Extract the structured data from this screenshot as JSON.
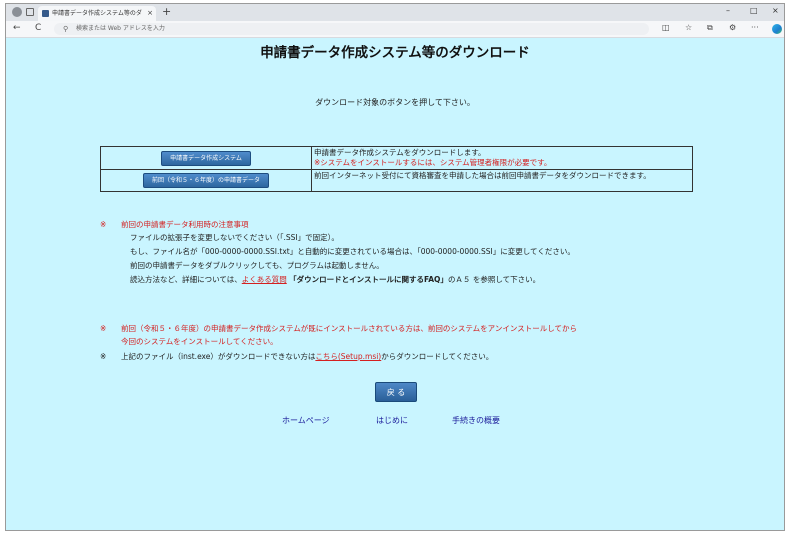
{
  "browser": {
    "tab_title": "申請書データ作成システム等のダウンロード",
    "tab_close": "×",
    "new_tab": "+",
    "address_placeholder": "検索または Web アドレスを入力",
    "nav_back": "←",
    "nav_refresh": "C",
    "min": "–",
    "max": "□",
    "close": "×"
  },
  "page": {
    "title": "申請書データ作成システム等のダウンロード",
    "instruction": "ダウンロード対象のボタンを押して下さい。",
    "downloads": [
      {
        "button": "申請書データ作成システム",
        "desc": "申請書データ作成システムをダウンロードします。",
        "note": "※システムをインストールするには、システム管理者権限が必要です。"
      },
      {
        "button": "前回（令和５・６年度）の申請書データ",
        "desc": "前回インターネット受付にて資格審査を申請した場合は前回申請書データをダウンロードできます。"
      }
    ],
    "notes1": {
      "mark": "※",
      "heading": "前回の申請書データ利用時の注意事項",
      "line1": "ファイルの拡張子を変更しないでください（「.SSI」で固定）。",
      "line2": "もし、ファイル名が「000-0000-0000.SSI.txt」と自動的に変更されている場合は、「000-0000-0000.SSI」に変更してください。",
      "line3": "前回の申請書データをダブルクリックしても、プログラムは起動しません。",
      "line4_pre": "読込方法など、詳細については、",
      "line4_link": "よくある質問",
      "line4_bold": "「ダウンロードとインストールに関するFAQ」",
      "line4_post": "のＡ５ を参照して下さい。"
    },
    "notes2": {
      "mark": "※",
      "line1": "前回（令和５・６年度）の申請書データ作成システムが既にインストールされている方は、前回のシステムをアンインストールしてから",
      "line2": "今回のシステムをインストールしてください。"
    },
    "notes3": {
      "mark": "※",
      "pre": "上記のファイル（inst.exe）がダウンロードできない方は",
      "link": "こちら(Setup.msi)",
      "post": "からダウンロードしてください。"
    },
    "back_button": "戻 る",
    "footer_links": [
      "ホームページ",
      "はじめに",
      "手続きの概要"
    ]
  },
  "colors": {
    "background": "#c9f5ff",
    "button": "#2d679f",
    "warning": "#d42020",
    "link": "#1a1a9a"
  }
}
